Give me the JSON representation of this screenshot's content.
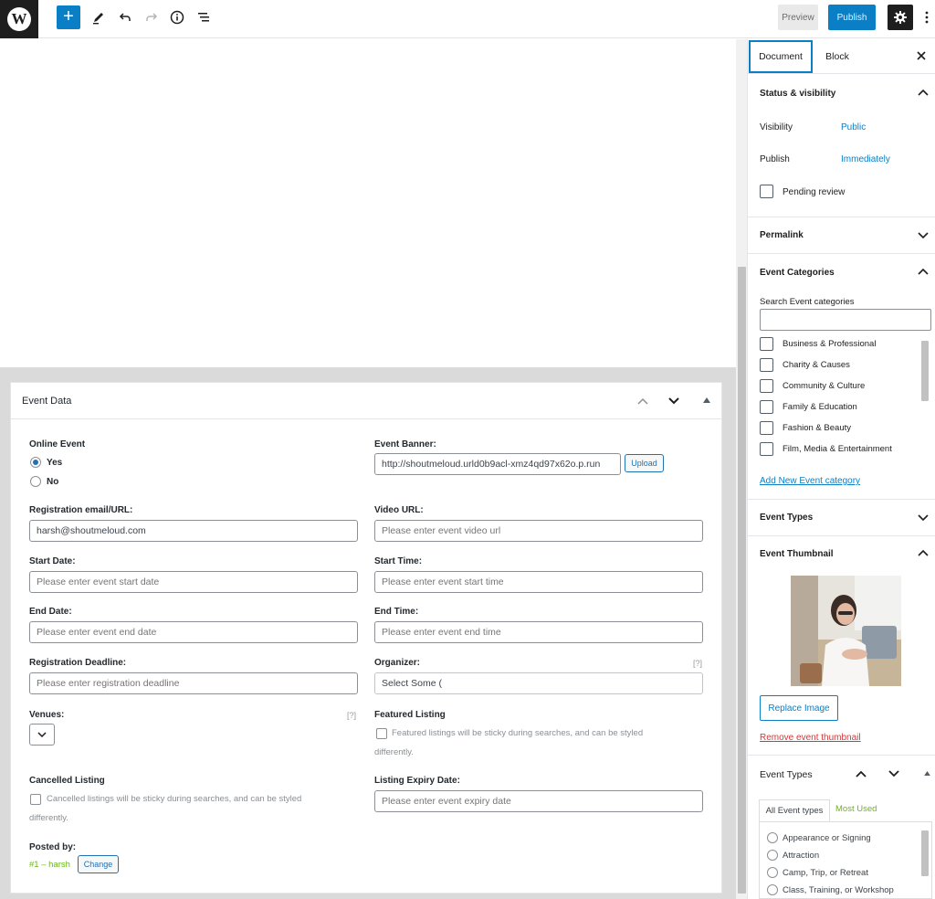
{
  "topbar": {
    "logo": "W",
    "add_label": "+",
    "preview_label": "Preview",
    "publish_label": "Publish",
    "icons": [
      "add-block-icon",
      "edit-tools-icon",
      "undo-icon",
      "redo-icon",
      "info-icon",
      "list-view-icon",
      "gear-icon",
      "more-vertical-icon"
    ]
  },
  "event_data": {
    "title": "Event Data",
    "online_event": {
      "label": "Online Event",
      "options": [
        "Yes",
        "No"
      ],
      "selected": "Yes"
    },
    "event_banner": {
      "label": "Event Banner:",
      "value": "http://shoutmeloud.urld0b9acl-xmz4qd97x62o.p.run",
      "upload_label": "Upload"
    },
    "registration": {
      "label": "Registration email/URL:",
      "value": "harsh@shoutmeloud.com"
    },
    "video_url": {
      "label": "Video URL:",
      "placeholder": "Please enter event video url"
    },
    "start_date": {
      "label": "Start Date:",
      "placeholder": "Please enter event start date"
    },
    "start_time": {
      "label": "Start Time:",
      "placeholder": "Please enter event start time"
    },
    "end_date": {
      "label": "End Date:",
      "placeholder": "Please enter event end date"
    },
    "end_time": {
      "label": "End Time:",
      "placeholder": "Please enter event end time"
    },
    "reg_deadline": {
      "label": "Registration Deadline:",
      "placeholder": "Please enter registration deadline"
    },
    "organizer": {
      "label": "Organizer:",
      "help": "[?]",
      "value": "Select Some ("
    },
    "venues": {
      "label": "Venues:",
      "help": "[?]"
    },
    "featured": {
      "label": "Featured Listing",
      "note_line1": "Featured listings will be sticky during searches, and can be styled",
      "note_line2": "differently."
    },
    "cancelled": {
      "label": "Cancelled Listing",
      "note_line1": "Cancelled listings will be sticky during searches, and can be styled",
      "note_line2": "differently."
    },
    "expiry": {
      "label": "Listing Expiry Date:",
      "placeholder": "Please enter event expiry date"
    },
    "posted_by": {
      "label": "Posted by:",
      "value": "#1 – harsh",
      "change_label": "Change"
    }
  },
  "sidebar": {
    "tabs": [
      "Document",
      "Block"
    ],
    "active_tab": "Document",
    "status": {
      "title": "Status & visibility",
      "visibility_label": "Visibility",
      "visibility_value": "Public",
      "publish_label": "Publish",
      "publish_value": "Immediately",
      "pending_label": "Pending review"
    },
    "permalink": {
      "title": "Permalink"
    },
    "event_categories": {
      "title": "Event Categories",
      "search_label": "Search Event categories",
      "items": [
        "Business & Professional",
        "Charity & Causes",
        "Community & Culture",
        "Family & Education",
        "Fashion & Beauty",
        "Film, Media & Entertainment"
      ],
      "add_link": "Add New Event category"
    },
    "event_types_1": {
      "title": "Event Types"
    },
    "thumbnail": {
      "title": "Event Thumbnail",
      "replace_label": "Replace Image",
      "remove_link": "Remove event thumbnail"
    },
    "event_types_2": {
      "title": "Event Types",
      "tab_all": "All Event types",
      "tab_most": "Most Used",
      "items": [
        "Appearance or Signing",
        "Attraction",
        "Camp, Trip, or Retreat",
        "Class, Training, or Workshop"
      ]
    }
  },
  "colors": {
    "accent": "#0a7fc6",
    "link_green": "#6bb51b",
    "remove_red": "#d63638",
    "dark": "#1e1e1e"
  }
}
